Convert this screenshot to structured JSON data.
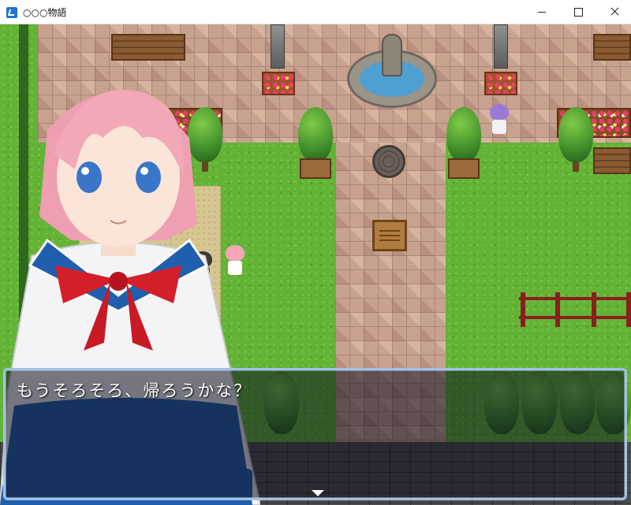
{
  "window": {
    "title": "○○○物語",
    "controls": [
      "minimize",
      "maximize",
      "close"
    ]
  },
  "scene": {
    "setting": "park plaza with fountain",
    "npcs": [
      {
        "name": "purple-haired-girl",
        "hair_color": "#9b7ad6"
      },
      {
        "name": "dark-haired-girl",
        "hair_color": "#3a3a3a"
      },
      {
        "name": "pink-haired-girl-sprite",
        "hair_color": "#f2a6b8"
      }
    ]
  },
  "portrait": {
    "character": "pink-haired schoolgirl",
    "hair_color": "#f2a8b6",
    "uniform_color": "#ffffff",
    "collar_color": "#1f5fae",
    "bow_color": "#d41f2a",
    "skirt_color": "#1f5fae"
  },
  "dialogue": {
    "text": "もうそろそろ、帰ろうかな？",
    "continue_icon": "down-triangle-icon"
  },
  "colors": {
    "message_border": "#9fc2ea",
    "grass": "#64b337",
    "brick": "#c7a28f"
  }
}
